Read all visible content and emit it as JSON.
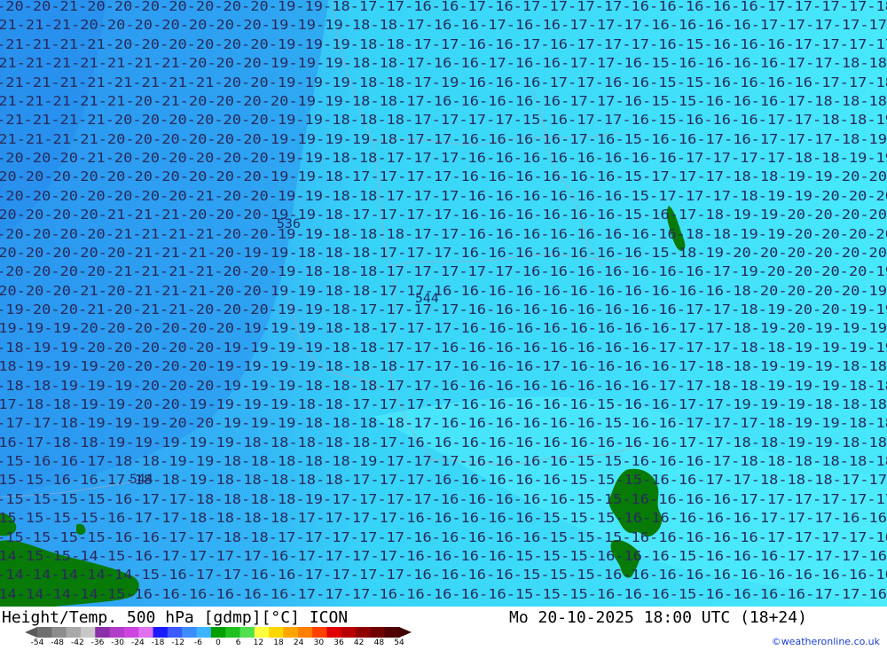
{
  "header": {
    "title": "Height/Temp. 500 hPa [gdmp][°C] ICON",
    "timestamp": "Mo 20-10-2025 18:00 UTC (18+24)",
    "credit": "©weatheronline.co.uk"
  },
  "scale": {
    "labels": [
      "-54",
      "-48",
      "-42",
      "-36",
      "-30",
      "-24",
      "-18",
      "-12",
      "-6",
      "0",
      "6",
      "12",
      "18",
      "24",
      "30",
      "36",
      "42",
      "48",
      "54"
    ],
    "colors": [
      "#707070",
      "#8c8c8c",
      "#a8a8a8",
      "#c8c8c8",
      "#8b2fa8",
      "#b03cc8",
      "#cc44e0",
      "#e070f0",
      "#1a1aff",
      "#3a5aff",
      "#3c8cff",
      "#3cb4ff",
      "#00a000",
      "#20c020",
      "#50e050",
      "#ffff40",
      "#ffd700",
      "#ffa500",
      "#ff7f00",
      "#ff4000",
      "#e00000",
      "#b80000",
      "#900000",
      "#700000",
      "#500000"
    ]
  },
  "map": {
    "colors": {
      "sea_cold": "#2ea8f5",
      "sea_mid": "#33ccf7",
      "sea_warm": "#44e4fb",
      "land": "#087a08",
      "contour": "#b0b0c8"
    },
    "height_labels": [
      "536",
      "544",
      "544"
    ],
    "temp_rows": [
      "-20-20-21-20-20-20-20-20-20-20-19-19-18-17-17-16-16-17-16-17-17-17-17-16-16-16-16-16-17-17-17-17-18",
      "-21-21-21-20-20-20-20-20-20-20-19-19-19-18-18-17-16-16-17-16-16-17-17-17-16-16-16-16-17-17-17-17-17",
      "-21-21-21-21-20-20-20-20-20-20-19-19-19-18-18-17-17-16-16-17-16-17-17-17-16-15-16-16-16-17-17-17-17",
      "-21-21-21-21-21-21-21-20-20-20-19-19-19-18-18-17-16-16-17-16-16-17-17-16-15-16-16-16-16-17-17-18-18",
      "-21-21-21-21-21-21-21-21-20-20-19-19-19-18-18-17-19-16-16-16-17-17-16-16-15-15-16-16-16-16-17-17-18",
      "-21-21-21-21-21-20-21-20-20-20-20-19-19-18-18-17-16-16-16-16-16-17-17-16-15-15-16-16-16-17-18-18-18",
      "-21-21-21-21-20-20-20-20-20-20-19-19-18-18-18-17-17-17-17-15-16-17-17-16-15-16-16-16-17-17-18-18-19",
      "-21-21-21-21-20-20-20-20-20-20-19-19-19-19-18-17-17-16-16-16-16-17-16-15-16-16-17-16-17-17-17-18-19",
      "-20-20-20-21-20-20-20-20-20-20-19-19-18-18-17-17-17-16-16-16-16-16-16-16-16-17-17-17-17-18-18-19-19",
      "-20-20-20-20-20-20-20-20-20-20-19-19-18-17-17-17-17-16-16-16-16-16-16-15-17-17-17-18-18-19-19-20-20",
      "-20-20-20-20-20-20-20-21-20-20-19-19-18-18-17-17-17-16-16-16-16-16-16-15-17-17-17-18-19-19-20-20-20",
      "-20-20-20-20-21-21-21-20-20-20-19-19-18-17-17-17-17-16-16-16-16-16-16-15-16-17-18-19-19-20-20-20-20",
      "-20-20-20-20-21-21-21-21-20-20-19-19-18-18-18-17-17-16-16-16-16-16-16-16-16-18-18-19-19-20-20-20-20",
      "-20-20-20-20-20-21-21-21-20-19-19-18-18-18-17-17-17-16-16-16-16-16-16-16-15-18-19-20-20-20-20-20-20",
      "-20-20-20-20-21-21-21-21-20-20-19-18-18-18-17-17-17-17-17-16-16-16-16-16-16-16-17-19-20-20-20-20-19",
      "-20-20-20-21-20-21-21-21-20-20-19-19-18-18-17-17-16-16-16-16-16-16-16-16-16-16-16-18-20-20-20-20-19",
      "-19-20-20-21-20-21-21-20-20-20-19-19-18-17-17-17-17-16-16-16-16-16-16-16-16-17-17-18-19-20-20-19-19",
      "-19-19-19-20-20-20-20-20-20-19-19-19-18-18-17-17-17-16-16-16-16-16-16-16-16-17-17-18-19-20-19-19-19",
      "-18-19-19-20-20-20-20-20-19-19-19-19-18-18-17-17-16-16-16-16-16-16-16-16-17-17-17-18-18-19-19-19-19",
      "-18-19-19-19-20-20-20-20-19-19-19-19-18-18-18-17-17-16-16-16-17-16-16-16-16-17-18-18-19-19-19-18-18",
      "-18-18-19-19-19-20-20-20-19-19-19-18-18-18-17-17-16-16-16-16-16-16-16-16-17-17-18-18-19-19-19-18-18",
      "-17-18-18-19-19-20-20-19-19-19-19-18-18-17-17-17-17-16-16-16-16-16-15-16-16-17-17-19-19-19-18-18-18",
      "-17-17-18-19-19-19-20-20-19-19-19-18-18-18-18-17-16-16-16-16-16-16-15-16-16-17-17-17-18-19-19-18-18",
      "-16-17-18-18-19-19-19-19-19-18-18-18-18-18-17-16-16-16-16-16-16-16-16-16-16-17-17-18-18-19-19-18-18",
      "-15-16-16-17-18-18-19-19-18-18-18-18-18-19-17-17-17-16-16-16-16-15-15-16-16-16-17-18-18-18-18-18-18",
      "-15-15-16-16-17-18-18-19-18-18-18-18-18-17-17-17-16-16-16-16-16-15-15-15-16-16-17-17-18-18-18-17-17",
      "-15-15-15-15-16-17-17-18-18-18-18-19-17-17-17-17-16-16-16-16-16-15-15-16-16-16-16-17-17-17-17-17-17",
      "-15-15-15-15-16-17-17-18-18-18-18-17-17-17-17-16-16-16-16-16-15-15-15-16-16-16-16-16-17-17-17-16-16",
      "-15-15-15-15-16-16-17-17-18-18-17-17-17-17-17-16-16-16-16-16-15-15-15-16-16-16-16-16-17-17-17-17-16",
      "-14-15-15-14-15-16-17-17-17-17-16-17-17-17-17-16-16-16-16-15-15-15-16-16-16-15-16-16-16-17-17-17-16",
      "-14-14-14-14-14-15-16-17-17-16-16-17-17-17-17-16-16-16-16-15-15-15-16-16-16-16-16-16-16-16-16-16-16",
      "-14-14-14-14-15-16-16-16-16-16-16-17-17-17-16-16-16-16-16-15-15-15-16-16-16-15-16-16-16-16-17-17-16"
    ]
  }
}
